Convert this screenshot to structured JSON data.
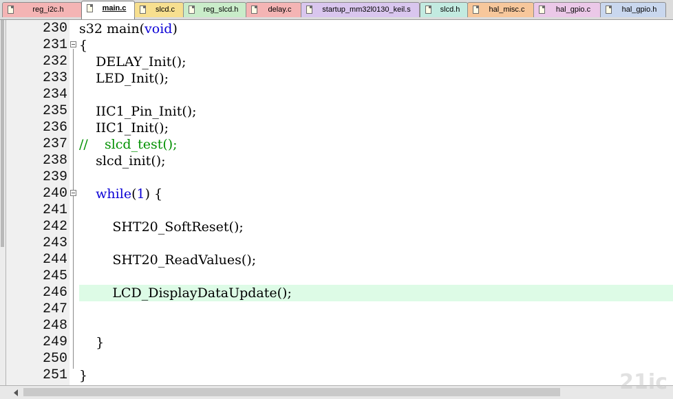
{
  "tabs": [
    {
      "label": "reg_i2c.h",
      "color": "#f4b4b4",
      "active": false
    },
    {
      "label": "main.c",
      "color": "#ffffff",
      "active": true
    },
    {
      "label": "slcd.c",
      "color": "#f7df8f",
      "active": false
    },
    {
      "label": "reg_slcd.h",
      "color": "#c9ecc9",
      "active": false
    },
    {
      "label": "delay.c",
      "color": "#f4b4b4",
      "active": false
    },
    {
      "label": "startup_mm32l0130_keil.s",
      "color": "#d9c6ee",
      "active": false
    },
    {
      "label": "slcd.h",
      "color": "#c2eae0",
      "active": false
    },
    {
      "label": "hal_misc.c",
      "color": "#f7c79b",
      "active": false
    },
    {
      "label": "hal_gpio.c",
      "color": "#ebc8e8",
      "active": false
    },
    {
      "label": "hal_gpio.h",
      "color": "#c9d7ee",
      "active": false
    }
  ],
  "editor": {
    "current_line": 246,
    "lines": [
      {
        "n": "230",
        "tokens": [
          {
            "t": "s32 main(",
            "c": ""
          },
          {
            "t": "void",
            "c": "kw"
          },
          {
            "t": ")",
            "c": ""
          }
        ]
      },
      {
        "n": "231",
        "tokens": [
          {
            "t": "{",
            "c": ""
          }
        ],
        "fold": true
      },
      {
        "n": "232",
        "tokens": [
          {
            "t": "    DELAY_Init();",
            "c": ""
          }
        ]
      },
      {
        "n": "233",
        "tokens": [
          {
            "t": "    LED_Init();",
            "c": ""
          }
        ]
      },
      {
        "n": "234",
        "tokens": []
      },
      {
        "n": "235",
        "tokens": [
          {
            "t": "    IIC1_Pin_Init();",
            "c": ""
          }
        ]
      },
      {
        "n": "236",
        "tokens": [
          {
            "t": "    IIC1_Init();",
            "c": ""
          }
        ]
      },
      {
        "n": "237",
        "tokens": [
          {
            "t": "//    slcd_test();",
            "c": "comment"
          }
        ]
      },
      {
        "n": "238",
        "tokens": [
          {
            "t": "    slcd_init();",
            "c": ""
          }
        ]
      },
      {
        "n": "239",
        "tokens": []
      },
      {
        "n": "240",
        "tokens": [
          {
            "t": "    ",
            "c": ""
          },
          {
            "t": "while",
            "c": "kw"
          },
          {
            "t": "(",
            "c": ""
          },
          {
            "t": "1",
            "c": "num"
          },
          {
            "t": ") {",
            "c": ""
          }
        ],
        "fold": true
      },
      {
        "n": "241",
        "tokens": []
      },
      {
        "n": "242",
        "tokens": [
          {
            "t": "        SHT20_SoftReset();",
            "c": ""
          }
        ]
      },
      {
        "n": "243",
        "tokens": []
      },
      {
        "n": "244",
        "tokens": [
          {
            "t": "        SHT20_ReadValues();",
            "c": ""
          }
        ]
      },
      {
        "n": "245",
        "tokens": []
      },
      {
        "n": "246",
        "tokens": [
          {
            "t": "        LCD_DisplayDataUpdate();",
            "c": ""
          }
        ]
      },
      {
        "n": "247",
        "tokens": []
      },
      {
        "n": "248",
        "tokens": []
      },
      {
        "n": "249",
        "tokens": [
          {
            "t": "    }",
            "c": ""
          }
        ]
      },
      {
        "n": "250",
        "tokens": []
      },
      {
        "n": "251",
        "tokens": [
          {
            "t": "}",
            "c": ""
          }
        ]
      }
    ]
  },
  "watermark": "21ic"
}
